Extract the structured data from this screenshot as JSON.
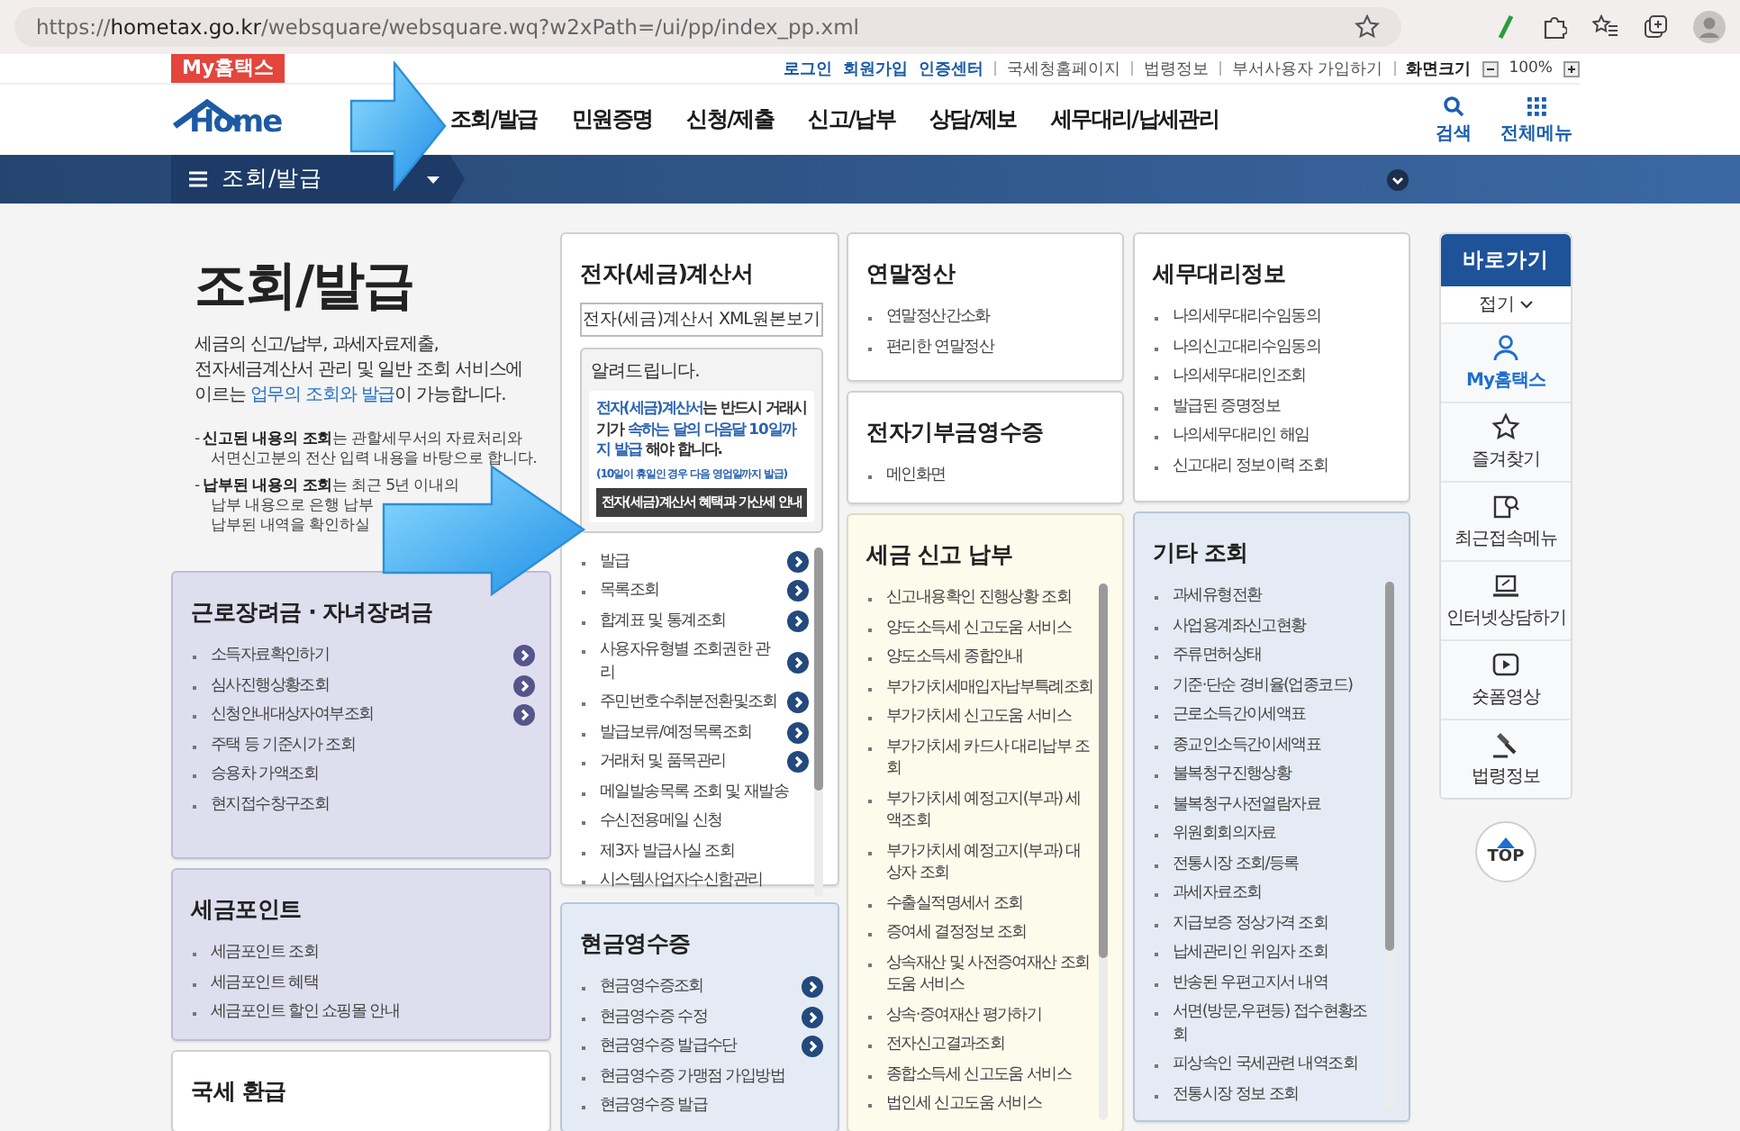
{
  "browser": {
    "url": "https://**hometax.go.kr**/websquare/websquare.wq?w2xPath=/ui/pp/index_pp.xml"
  },
  "header": {
    "my_button": "My홈택스",
    "account_links": [
      "로그인",
      "회원가입",
      "인증센터"
    ],
    "site_links": [
      "국세청홈페이지",
      "법령정보",
      "부서사용자 가입하기"
    ],
    "zoom": {
      "label": "화면크기",
      "value": "100%"
    },
    "logo": "Home",
    "nav": [
      "조회/발급",
      "민원증명",
      "신청/제출",
      "신고/납부",
      "상담/제보",
      "세무대리/납세관리"
    ],
    "search": "검색",
    "all_menu": "전체메뉴"
  },
  "breadcrumb": {
    "label": "조회/발급"
  },
  "intro": {
    "title": "조회/발급",
    "description": [
      "세금의 신고/납부, 과세자료제출,",
      "전자세금계산서 관리 및 일반 조회 서비스에",
      "이르는 **업무의 조회와 발급**이 가능합니다."
    ],
    "notes": [
      [
        "- **신고된 내용의 조회**는 관할세무서의 자료처리와",
        "서면신고분의 전산 입력 내용을 바탕으로 합니다."
      ],
      [
        "- **납부된 내용의 조회**는 최근 5년 이내의",
        "납부 내용으로 은행 납부",
        "납부된 내역을 확인하실"
      ]
    ]
  },
  "columns": [
    {
      "cards": [
        {
          "title": "근로장려금 · 자녀장려금",
          "color": "#dedeef",
          "items": [
            {
              "label": "소득자료확인하기",
              "more": true
            },
            {
              "label": "심사진행상황조회",
              "more": true
            },
            {
              "label": "신청안내대상자여부조회",
              "more": true
            },
            {
              "label": "주택 등 기준시가 조회",
              "more": false
            },
            {
              "label": "승용차 가액조회",
              "more": false
            },
            {
              "label": "현지접수창구조회",
              "more": false
            }
          ]
        },
        {
          "title": "세금포인트",
          "color": "#dedeef",
          "items": [
            {
              "label": "세금포인트 조회",
              "more": false
            },
            {
              "label": "세금포인트 혜택",
              "more": false
            },
            {
              "label": "세금포인트 할인 쇼핑몰 안내",
              "more": false
            }
          ]
        },
        {
          "title": "국세 환급",
          "color": "#ffffff"
        }
      ]
    },
    {
      "cards": [
        {
          "title": "전자(세금)계산서",
          "color": "#ffffff",
          "scrollable": true,
          "xml_button": "전자(세금)계산서 XML원본보기",
          "notice": {
            "title": "알려드립니다.",
            "text": "**전자(세금)계산서**는 반드시 거래시기가 **속하는 달의 다음달 10일까지 발급** 해야 합니다.",
            "subtext": "(10일이 휴일인 경우 다음 영업일까지 발급)",
            "button": "전자(세금)계산서 혜택과 가산세 안내"
          },
          "items": [
            {
              "label": "발급",
              "more": true
            },
            {
              "label": "목록조회",
              "more": true
            },
            {
              "label": "합계표 및 통계조회",
              "more": true
            },
            {
              "label": "사용자유형별 조회권한 관리",
              "more": true
            },
            {
              "label": "주민번호수취분전환및조회",
              "more": true
            },
            {
              "label": "발급보류/예정목록조회",
              "more": true
            },
            {
              "label": "거래처 및 품목관리",
              "more": true
            },
            {
              "label": "메일발송목록 조회 및 재발송",
              "more": false
            },
            {
              "label": "수신전용메일 신청",
              "more": false
            },
            {
              "label": "제3자 발급사실 조회",
              "more": false
            },
            {
              "label": "시스템사업자수신함관리",
              "more": false
            }
          ]
        },
        {
          "title": "현금영수증",
          "color": "#e4ebf4",
          "items": [
            {
              "label": "현금영수증조회",
              "more": true
            },
            {
              "label": "현금영수증 수정",
              "more": true
            },
            {
              "label": "현금영수증 발급수단",
              "more": true
            },
            {
              "label": "현금영수증 가맹점 가입방법",
              "more": false
            },
            {
              "label": "현금영수증 발급",
              "more": false
            }
          ]
        }
      ]
    },
    {
      "cards": [
        {
          "title": "연말정산",
          "color": "#ffffff",
          "items": [
            {
              "label": "연말정산간소화",
              "more": false
            },
            {
              "label": "편리한 연말정산",
              "more": false
            }
          ]
        },
        {
          "title": "전자기부금영수증",
          "color": "#ffffff",
          "items": [
            {
              "label": "메인화면",
              "more": false
            }
          ]
        },
        {
          "title": "세금 신고 납부",
          "color": "#fdfcec",
          "scrollable": true,
          "items": [
            {
              "label": "신고내용확인 진행상황 조회",
              "more": false
            },
            {
              "label": "양도소득세 신고도움 서비스",
              "more": false
            },
            {
              "label": "양도소득세 종합안내",
              "more": false
            },
            {
              "label": "부가가치세매입자납부특례조회",
              "more": false
            },
            {
              "label": "부가가치세 신고도움 서비스",
              "more": false
            },
            {
              "label": "부가가치세 카드사 대리납부 조회",
              "more": false
            },
            {
              "label": "부가가치세 예정고지(부과) 세액조회",
              "more": false
            },
            {
              "label": "부가가치세 예정고지(부과) 대상자 조회",
              "more": false
            },
            {
              "label": "수출실적명세서 조회",
              "more": false
            },
            {
              "label": "증여세 결정정보 조회",
              "more": false
            },
            {
              "label": "상속재산 및 사전증여재산 조회 도움 서비스",
              "more": false
            },
            {
              "label": "상속·증여재산 평가하기",
              "more": false
            },
            {
              "label": "전자신고결과조회",
              "more": false
            },
            {
              "label": "종합소득세 신고도움 서비스",
              "more": false
            },
            {
              "label": "법인세 신고도움 서비스",
              "more": false
            }
          ]
        }
      ]
    },
    {
      "cards": [
        {
          "title": "세무대리정보",
          "color": "#ffffff",
          "items": [
            {
              "label": "나의세무대리수임동의",
              "more": false
            },
            {
              "label": "나의신고대리수임동의",
              "more": false
            },
            {
              "label": "나의세무대리인조회",
              "more": false
            },
            {
              "label": "발급된 증명정보",
              "more": false
            },
            {
              "label": "나의세무대리인 해임",
              "more": false
            },
            {
              "label": "신고대리 정보이력 조회",
              "more": false
            }
          ]
        },
        {
          "title": "기타 조회",
          "color": "#e4ebf4",
          "scrollable": true,
          "items": [
            {
              "label": "과세유형전환",
              "more": false
            },
            {
              "label": "사업용계좌신고현황",
              "more": false
            },
            {
              "label": "주류면허상태",
              "more": false
            },
            {
              "label": "기준·단순 경비율(업종코드)",
              "more": false
            },
            {
              "label": "근로소득간이세액표",
              "more": false
            },
            {
              "label": "종교인소득간이세액표",
              "more": false
            },
            {
              "label": "불복청구진행상황",
              "more": false
            },
            {
              "label": "불복청구사전열람자료",
              "more": false
            },
            {
              "label": "위원회회의자료",
              "more": false
            },
            {
              "label": "전통시장 조회/등록",
              "more": false
            },
            {
              "label": "과세자료조회",
              "more": false
            },
            {
              "label": "지급보증 정상가격 조회",
              "more": false
            },
            {
              "label": "납세관리인 위임자 조회",
              "more": false
            },
            {
              "label": "반송된 우편고지서 내역",
              "more": false
            },
            {
              "label": "서면(방문,우편등) 접수현황조회",
              "more": false
            },
            {
              "label": "피상속인 국세관련 내역조회",
              "more": false
            },
            {
              "label": "전통시장 정보 조회",
              "more": false
            }
          ]
        }
      ]
    }
  ],
  "quick_menu": {
    "title": "바로가기",
    "collapse": "접기",
    "items": [
      {
        "label": "My홈택스",
        "highlighted": true
      },
      {
        "label": "즐겨찾기",
        "highlighted": false
      },
      {
        "label": "최근접속메뉴",
        "highlighted": false
      },
      {
        "label": "인터넷상담하기",
        "highlighted": false
      },
      {
        "label": "숏폼영상",
        "highlighted": false
      },
      {
        "label": "법령정보",
        "highlighted": false
      }
    ],
    "top": "TOP"
  }
}
